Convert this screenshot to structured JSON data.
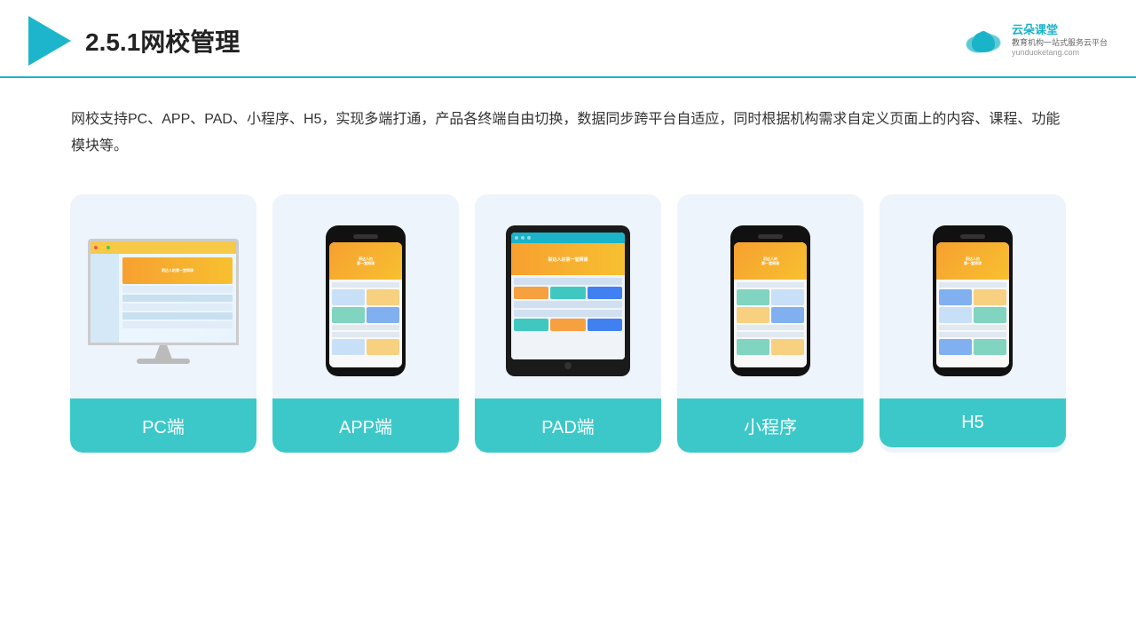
{
  "header": {
    "title": "2.5.1网校管理",
    "brand_name": "云朵课堂",
    "brand_sub": "教育机构一站\n式服务云平台",
    "brand_url": "yunduoketang.com"
  },
  "description": {
    "text": "网校支持PC、APP、PAD、小程序、H5，实现多端打通，产品各终端自由切换，数据同步跨平台自适应，同时根据机构需求自定义页面上的内容、课程、功能模块等。"
  },
  "cards": [
    {
      "label": "PC端",
      "type": "pc"
    },
    {
      "label": "APP端",
      "type": "phone"
    },
    {
      "label": "PAD端",
      "type": "tablet"
    },
    {
      "label": "小程序",
      "type": "phone"
    },
    {
      "label": "H5",
      "type": "phone"
    }
  ]
}
